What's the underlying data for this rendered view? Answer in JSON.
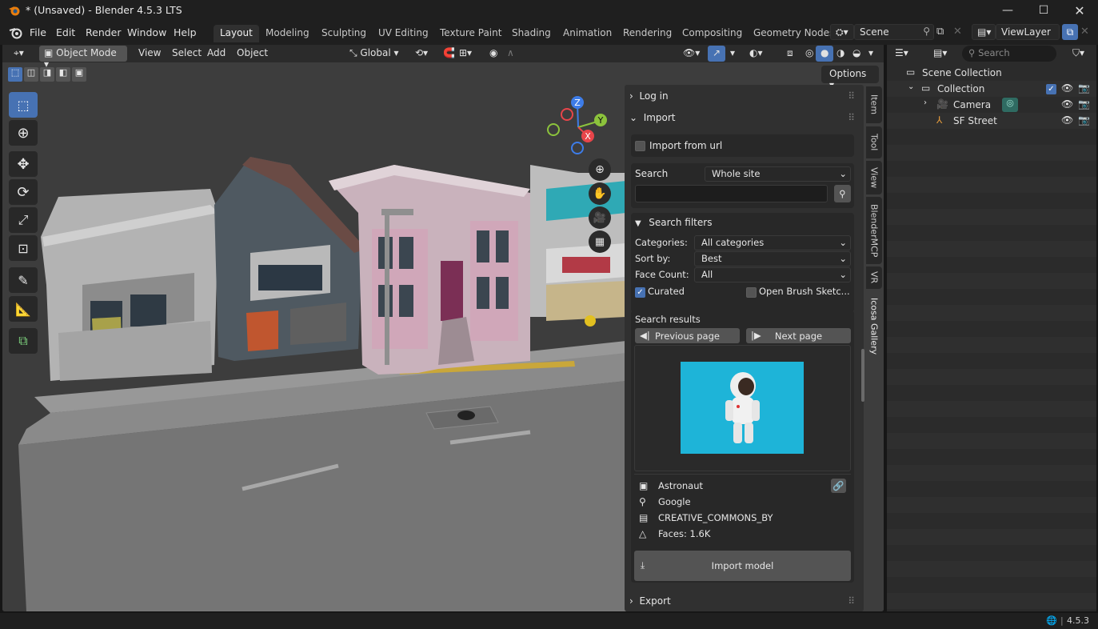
{
  "window": {
    "title": "* (Unsaved) - Blender 4.5.3 LTS",
    "controls": [
      "minimize",
      "maximize",
      "close"
    ]
  },
  "menubar": {
    "items": [
      "File",
      "Edit",
      "Render",
      "Window",
      "Help"
    ],
    "workspaces": [
      "Layout",
      "Modeling",
      "Sculpting",
      "UV Editing",
      "Texture Paint",
      "Shading",
      "Animation",
      "Rendering",
      "Compositing",
      "Geometry Nodes"
    ],
    "active_workspace": "Layout",
    "scene": "Scene",
    "view_layer": "ViewLayer"
  },
  "viewport_header": {
    "mode": "Object Mode",
    "menus": [
      "View",
      "Select",
      "Add",
      "Object"
    ],
    "orientation": "Global",
    "options": "Options"
  },
  "gizmo": {
    "z": "Z",
    "y": "Y",
    "x": "X"
  },
  "npanel": {
    "tabs": [
      "Item",
      "Tool",
      "View",
      "BlenderMCP",
      "VR",
      "Icosa Gallery"
    ],
    "active_tab": "Icosa Gallery",
    "login": "Log in",
    "import": "Import",
    "import_from_url": "Import from url",
    "search_label": "Search",
    "search_scope": "Whole site",
    "search_value": "",
    "search_filters": "Search filters",
    "filters": [
      {
        "label": "Categories:",
        "value": "All categories"
      },
      {
        "label": "Sort by:",
        "value": "Best"
      },
      {
        "label": "Face Count:",
        "value": "All"
      }
    ],
    "curated": "Curated",
    "curated_checked": true,
    "open_brush": "Open Brush Sketc...",
    "open_brush_checked": false,
    "search_results": "Search results",
    "previous_page": "Previous page",
    "next_page": "Next page",
    "result": {
      "name": "Astronaut",
      "author": "Google",
      "license": "CREATIVE_COMMONS_BY",
      "faces": "Faces: 1.6K"
    },
    "import_model": "Import model",
    "export": "Export"
  },
  "outliner": {
    "search_placeholder": "Search",
    "items": [
      {
        "name": "Scene Collection",
        "depth": 0
      },
      {
        "name": "Collection",
        "depth": 1
      },
      {
        "name": "Camera",
        "depth": 2
      },
      {
        "name": "SF Street",
        "depth": 2
      }
    ]
  },
  "statusbar": {
    "version": "4.5.3"
  },
  "colors": {
    "accent": "#4772b3",
    "panel": "#303030",
    "viewport": "#3d3d3d",
    "thumbnail_bg": "#1eb4d8"
  }
}
